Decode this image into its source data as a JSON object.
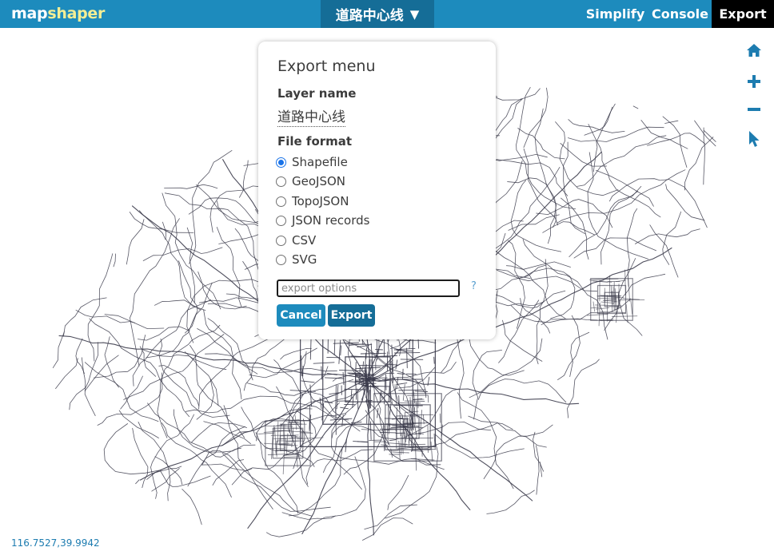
{
  "app": {
    "logo_part1": "map",
    "logo_part2": "shaper",
    "colors": {
      "bar": "#1d8bbd",
      "bar_dark": "#156d97",
      "logo_accent": "#f3ee95",
      "map_lines": "#3a3a4a"
    }
  },
  "header": {
    "layer_selector": {
      "label": "道路中心线",
      "caret": "▼"
    },
    "nav": [
      {
        "label": "Simplify"
      },
      {
        "label": "Console"
      },
      {
        "label": "Export",
        "active": true
      }
    ]
  },
  "map": {
    "coords_readout": "116.7527,39.9942",
    "tools": [
      "home-icon",
      "zoom-in-icon",
      "zoom-out-icon",
      "pointer-icon"
    ]
  },
  "export_dialog": {
    "title": "Export menu",
    "layer_name_label": "Layer name",
    "layer_name_value": "道路中心线",
    "file_format_label": "File format",
    "formats": [
      {
        "label": "Shapefile",
        "checked": true
      },
      {
        "label": "GeoJSON",
        "checked": false
      },
      {
        "label": "TopoJSON",
        "checked": false
      },
      {
        "label": "JSON records",
        "checked": false
      },
      {
        "label": "CSV",
        "checked": false
      },
      {
        "label": "SVG",
        "checked": false
      }
    ],
    "options_placeholder": "export options",
    "help": "?",
    "cancel_label": "Cancel",
    "export_label": "Export"
  }
}
